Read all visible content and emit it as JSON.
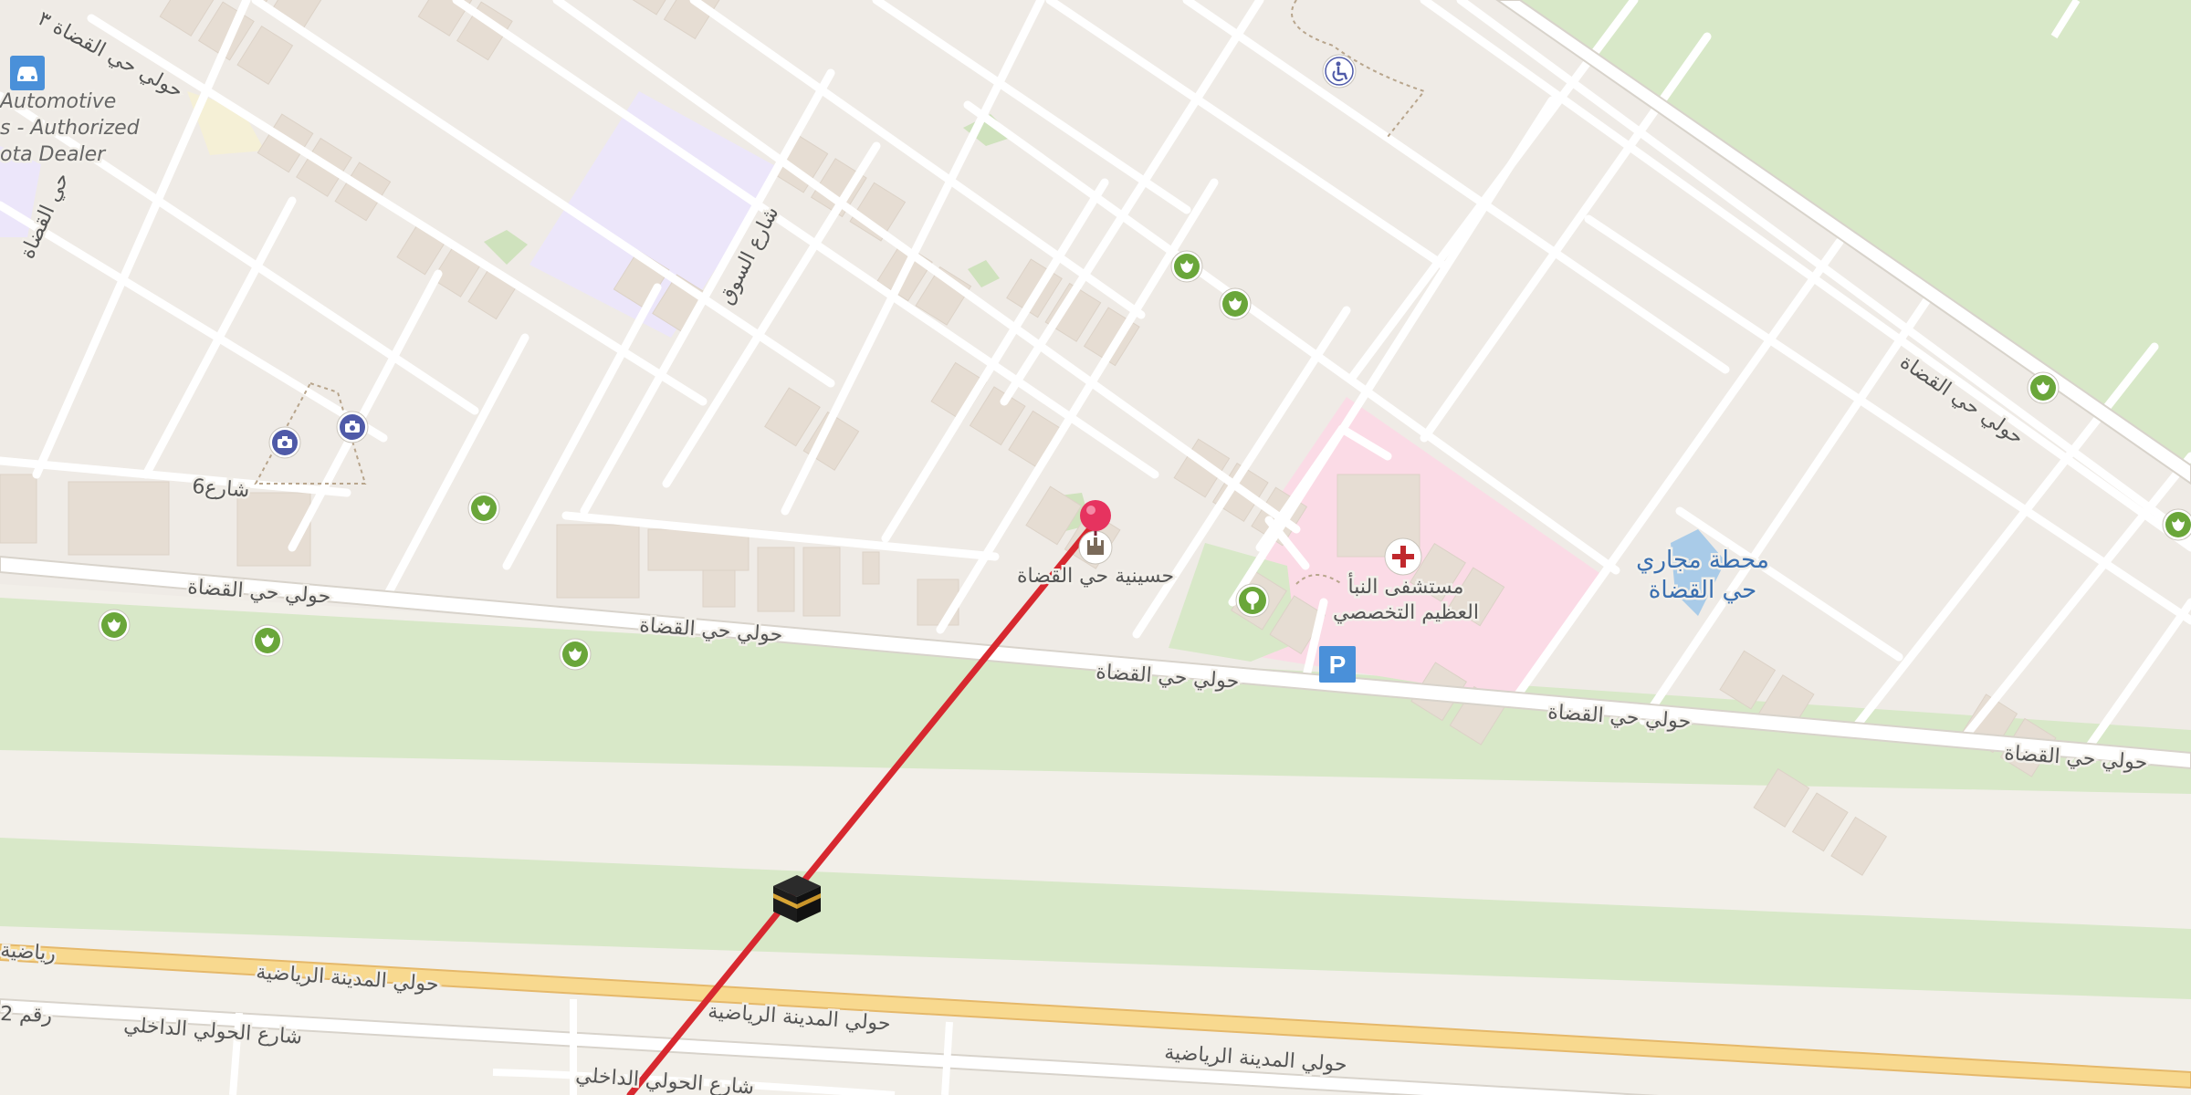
{
  "map": {
    "colors": {
      "background": "#f2efe9",
      "block": "#efeae3",
      "building": "#e6ddd3",
      "road": "#ffffff",
      "green": "#d8e8c8",
      "hospital": "#fbdbe6",
      "school": "#ede8fb",
      "highway": "#f8d98f",
      "route": "#d7282f",
      "pin": "#e6335f",
      "water": "#a9cbe8"
    },
    "labels": {
      "road_qudat_1": "حولي حي القضاة",
      "road_qudat_2": "حولي حي القضاة",
      "road_qudat_3": "حولي حي القضاة",
      "road_qudat_4": "حولي حي القضاة",
      "road_qudat_5": "حولي حي القضاة",
      "road_qudat_ne": "حولي حي القضاة",
      "road_qudat_topleft": "حولي حي القضاة ٣",
      "road_qudat_left": "حي القضاة",
      "road_souq": "شارع السوق",
      "road_six": "شارع6",
      "road_madina_1": "حولي المدينة الرياضية",
      "road_madina_2": "حولي المدينة الرياضية",
      "road_madina_3": "حولي المدينة الرياضية",
      "road_madina_left": "رياضية",
      "road_dakhili_1": "شارع  الحولي الداخلي",
      "road_dakhili_2": "شارع  الحولي الداخلي",
      "road_raqam2": "رقم 2",
      "mosque_label": "حسينية حي القضاة",
      "hospital_line1": "مستشفى النبأ",
      "hospital_line2": "العظيم التخصصي",
      "station_line1": "محطة مجاري",
      "station_line2": "حي القضاة",
      "dealer_line1": "Automotive",
      "dealer_line2": "s - Authorized",
      "dealer_line3": "ota Dealer"
    },
    "icons": {
      "garden": "garden-icon",
      "camera": "camera-icon",
      "car": "car-dealer-icon",
      "wheelchair": "wheelchair-icon",
      "hospital": "hospital-cross-icon",
      "parking": "parking-icon",
      "park": "park-tree-icon",
      "mosque": "mosque-icon",
      "kaaba": "kaaba-icon",
      "pin": "location-pin-icon"
    },
    "parking_glyph": "P"
  }
}
